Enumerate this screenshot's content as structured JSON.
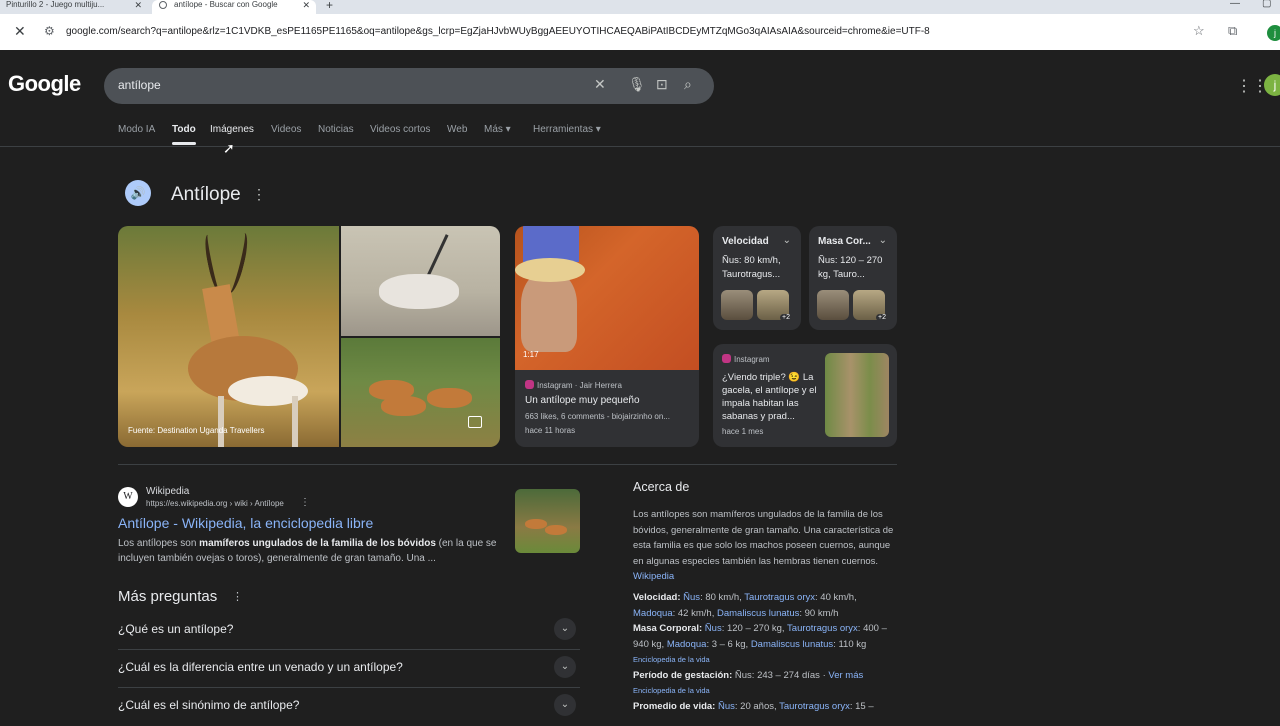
{
  "browser": {
    "tabs": [
      {
        "title": "Pinturillo 2 - Juego multiju..."
      },
      {
        "title": "antílope - Buscar con Google"
      }
    ],
    "new_tab_icon": "plus-icon",
    "url": "google.com/search?q=antilope&rlz=1C1VDKB_esPE1165PE1165&oq=antilope&gs_lcrp=EgZjaHJvbWUyBggAEEUYOTIHCAEQABiPAtIBCDEyMTZqMGo3qAIAsAIA&sourceid=chrome&ie=UTF-8",
    "profile_initial": "j"
  },
  "google": {
    "logo": "Google",
    "query": "antílope",
    "avatar_initial": "j"
  },
  "nav": {
    "tabs": [
      "Modo IA",
      "Todo",
      "Imágenes",
      "Videos",
      "Noticias",
      "Videos cortos",
      "Web",
      "Más ▾",
      "Herramientas ▾"
    ],
    "active": "Todo"
  },
  "entity": {
    "title": "Antílope",
    "image_caption": "Fuente: Destination Uganda Travellers",
    "video": {
      "duration": "1:17",
      "source": "Instagram · Jair Herrera",
      "title": "Un antílope muy pequeño",
      "meta": "663 likes, 6 comments - biojairzinho on...",
      "time": "hace 11 horas"
    },
    "facts": [
      {
        "label": "Velocidad",
        "value": "Ñus: 80 km/h, Taurotragus...",
        "more": "+2"
      },
      {
        "label": "Masa Cor...",
        "value": "Ñus: 120 – 270 kg, Tauro...",
        "more": "+2"
      }
    ],
    "instagram": {
      "source": "Instagram",
      "text": "¿Viendo triple? 😉 La gacela, el antílope y el impala habitan las sabanas y prad...",
      "time": "hace 1 mes"
    }
  },
  "result": {
    "site": "Wikipedia",
    "url": "https://es.wikipedia.org › wiki › Antílope",
    "title": "Antílope - Wikipedia, la enciclopedia libre",
    "snippet_pre": "Los antílopes son ",
    "snippet_bold": "mamíferos ungulados de la familia de los bóvidos",
    "snippet_post": " (en la que se incluyen también ovejas o toros), generalmente de gran tamaño. Una ..."
  },
  "questions": {
    "title": "Más preguntas",
    "items": [
      "¿Qué es un antílope?",
      "¿Cuál es la diferencia entre un venado y un antílope?",
      "¿Cuál es el sinónimo de antílope?"
    ]
  },
  "about": {
    "title": "Acerca de",
    "desc": "Los antílopes son mamíferos ungulados de la familia de los bóvidos, generalmente de gran tamaño. Una característica de esta familia es que solo los machos poseen cuernos, aunque en algunas especies también las hembras tienen cuernos.",
    "desc_link": "Wikipedia",
    "velocidad_label": "Velocidad:",
    "masa_label": "Masa Corporal:",
    "gestacion_label": "Período de gestación:",
    "gestacion_value": "Ñus: 243 – 274 días",
    "ver_mas": "Ver más",
    "vida_label": "Promedio de vida:",
    "source": "Enciclopedia de la vida"
  }
}
